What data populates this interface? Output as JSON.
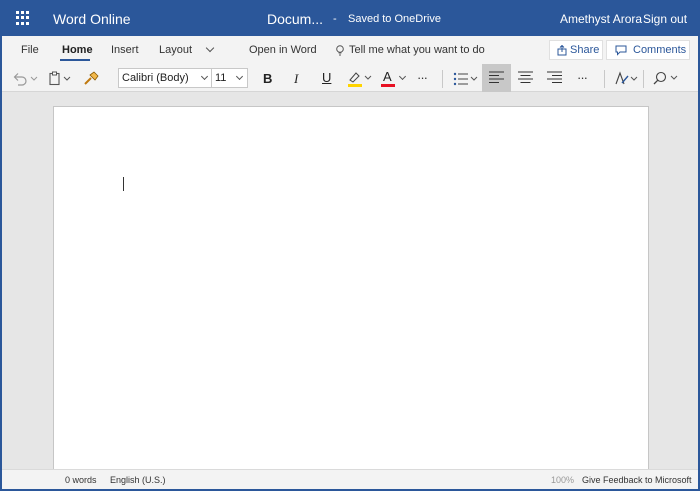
{
  "app": {
    "name": "Word Online",
    "document_title": "Docum...",
    "separator": "-",
    "save_status": "Saved to OneDrive",
    "user_name": "Amethyst Arora",
    "sign_out": "Sign out"
  },
  "ribbon": {
    "tabs": [
      "File",
      "Home",
      "Insert",
      "Layout"
    ],
    "active_tab": "Home",
    "open_in_word": "Open in Word",
    "tell_me": "Tell me what you want to do",
    "share": "Share",
    "comments": "Comments"
  },
  "toolbar": {
    "font_name": "Calibri (Body)",
    "font_size": "11",
    "bold": "B",
    "italic": "I",
    "underline": "U",
    "font_color_letter": "A",
    "more": "···",
    "highlight_color": "#ffd400",
    "font_color": "#e81123"
  },
  "status_bar": {
    "word_count": "0 words",
    "language": "English (U.S.)",
    "zoom": "100%",
    "feedback": "Give Feedback to Microsoft"
  },
  "colors": {
    "brand": "#2b579a",
    "ribbon_bg": "#f3f3f3",
    "canvas_bg": "#e6e6e6"
  }
}
